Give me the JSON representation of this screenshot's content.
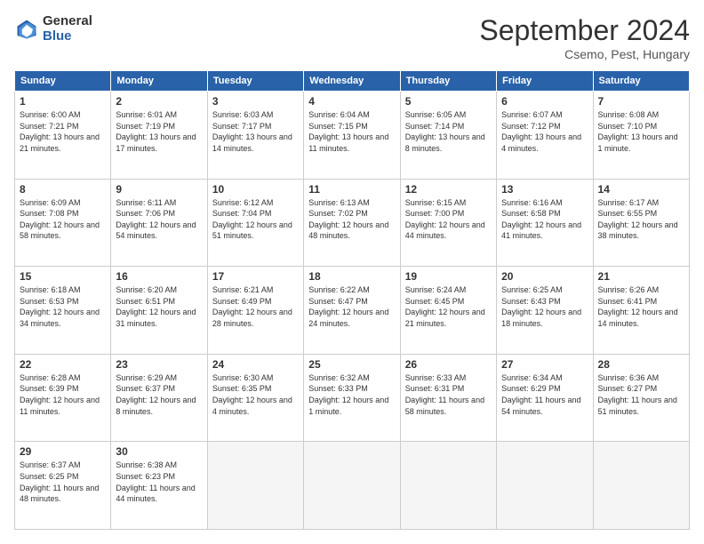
{
  "header": {
    "logo_general": "General",
    "logo_blue": "Blue",
    "month_title": "September 2024",
    "location": "Csemo, Pest, Hungary"
  },
  "days_of_week": [
    "Sunday",
    "Monday",
    "Tuesday",
    "Wednesday",
    "Thursday",
    "Friday",
    "Saturday"
  ],
  "weeks": [
    [
      {
        "day": "1",
        "sunrise": "Sunrise: 6:00 AM",
        "sunset": "Sunset: 7:21 PM",
        "daylight": "Daylight: 13 hours and 21 minutes."
      },
      {
        "day": "2",
        "sunrise": "Sunrise: 6:01 AM",
        "sunset": "Sunset: 7:19 PM",
        "daylight": "Daylight: 13 hours and 17 minutes."
      },
      {
        "day": "3",
        "sunrise": "Sunrise: 6:03 AM",
        "sunset": "Sunset: 7:17 PM",
        "daylight": "Daylight: 13 hours and 14 minutes."
      },
      {
        "day": "4",
        "sunrise": "Sunrise: 6:04 AM",
        "sunset": "Sunset: 7:15 PM",
        "daylight": "Daylight: 13 hours and 11 minutes."
      },
      {
        "day": "5",
        "sunrise": "Sunrise: 6:05 AM",
        "sunset": "Sunset: 7:14 PM",
        "daylight": "Daylight: 13 hours and 8 minutes."
      },
      {
        "day": "6",
        "sunrise": "Sunrise: 6:07 AM",
        "sunset": "Sunset: 7:12 PM",
        "daylight": "Daylight: 13 hours and 4 minutes."
      },
      {
        "day": "7",
        "sunrise": "Sunrise: 6:08 AM",
        "sunset": "Sunset: 7:10 PM",
        "daylight": "Daylight: 13 hours and 1 minute."
      }
    ],
    [
      {
        "day": "8",
        "sunrise": "Sunrise: 6:09 AM",
        "sunset": "Sunset: 7:08 PM",
        "daylight": "Daylight: 12 hours and 58 minutes."
      },
      {
        "day": "9",
        "sunrise": "Sunrise: 6:11 AM",
        "sunset": "Sunset: 7:06 PM",
        "daylight": "Daylight: 12 hours and 54 minutes."
      },
      {
        "day": "10",
        "sunrise": "Sunrise: 6:12 AM",
        "sunset": "Sunset: 7:04 PM",
        "daylight": "Daylight: 12 hours and 51 minutes."
      },
      {
        "day": "11",
        "sunrise": "Sunrise: 6:13 AM",
        "sunset": "Sunset: 7:02 PM",
        "daylight": "Daylight: 12 hours and 48 minutes."
      },
      {
        "day": "12",
        "sunrise": "Sunrise: 6:15 AM",
        "sunset": "Sunset: 7:00 PM",
        "daylight": "Daylight: 12 hours and 44 minutes."
      },
      {
        "day": "13",
        "sunrise": "Sunrise: 6:16 AM",
        "sunset": "Sunset: 6:58 PM",
        "daylight": "Daylight: 12 hours and 41 minutes."
      },
      {
        "day": "14",
        "sunrise": "Sunrise: 6:17 AM",
        "sunset": "Sunset: 6:55 PM",
        "daylight": "Daylight: 12 hours and 38 minutes."
      }
    ],
    [
      {
        "day": "15",
        "sunrise": "Sunrise: 6:18 AM",
        "sunset": "Sunset: 6:53 PM",
        "daylight": "Daylight: 12 hours and 34 minutes."
      },
      {
        "day": "16",
        "sunrise": "Sunrise: 6:20 AM",
        "sunset": "Sunset: 6:51 PM",
        "daylight": "Daylight: 12 hours and 31 minutes."
      },
      {
        "day": "17",
        "sunrise": "Sunrise: 6:21 AM",
        "sunset": "Sunset: 6:49 PM",
        "daylight": "Daylight: 12 hours and 28 minutes."
      },
      {
        "day": "18",
        "sunrise": "Sunrise: 6:22 AM",
        "sunset": "Sunset: 6:47 PM",
        "daylight": "Daylight: 12 hours and 24 minutes."
      },
      {
        "day": "19",
        "sunrise": "Sunrise: 6:24 AM",
        "sunset": "Sunset: 6:45 PM",
        "daylight": "Daylight: 12 hours and 21 minutes."
      },
      {
        "day": "20",
        "sunrise": "Sunrise: 6:25 AM",
        "sunset": "Sunset: 6:43 PM",
        "daylight": "Daylight: 12 hours and 18 minutes."
      },
      {
        "day": "21",
        "sunrise": "Sunrise: 6:26 AM",
        "sunset": "Sunset: 6:41 PM",
        "daylight": "Daylight: 12 hours and 14 minutes."
      }
    ],
    [
      {
        "day": "22",
        "sunrise": "Sunrise: 6:28 AM",
        "sunset": "Sunset: 6:39 PM",
        "daylight": "Daylight: 12 hours and 11 minutes."
      },
      {
        "day": "23",
        "sunrise": "Sunrise: 6:29 AM",
        "sunset": "Sunset: 6:37 PM",
        "daylight": "Daylight: 12 hours and 8 minutes."
      },
      {
        "day": "24",
        "sunrise": "Sunrise: 6:30 AM",
        "sunset": "Sunset: 6:35 PM",
        "daylight": "Daylight: 12 hours and 4 minutes."
      },
      {
        "day": "25",
        "sunrise": "Sunrise: 6:32 AM",
        "sunset": "Sunset: 6:33 PM",
        "daylight": "Daylight: 12 hours and 1 minute."
      },
      {
        "day": "26",
        "sunrise": "Sunrise: 6:33 AM",
        "sunset": "Sunset: 6:31 PM",
        "daylight": "Daylight: 11 hours and 58 minutes."
      },
      {
        "day": "27",
        "sunrise": "Sunrise: 6:34 AM",
        "sunset": "Sunset: 6:29 PM",
        "daylight": "Daylight: 11 hours and 54 minutes."
      },
      {
        "day": "28",
        "sunrise": "Sunrise: 6:36 AM",
        "sunset": "Sunset: 6:27 PM",
        "daylight": "Daylight: 11 hours and 51 minutes."
      }
    ],
    [
      {
        "day": "29",
        "sunrise": "Sunrise: 6:37 AM",
        "sunset": "Sunset: 6:25 PM",
        "daylight": "Daylight: 11 hours and 48 minutes."
      },
      {
        "day": "30",
        "sunrise": "Sunrise: 6:38 AM",
        "sunset": "Sunset: 6:23 PM",
        "daylight": "Daylight: 11 hours and 44 minutes."
      },
      null,
      null,
      null,
      null,
      null
    ]
  ]
}
